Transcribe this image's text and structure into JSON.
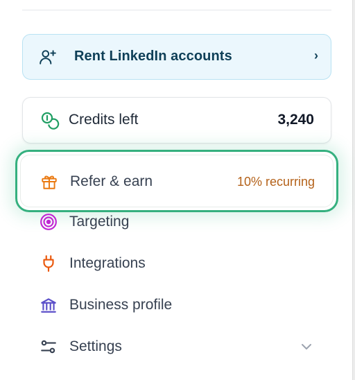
{
  "rent_card": {
    "label": "Rent LinkedIn accounts",
    "chevron": "›",
    "icon": "user-plus-icon"
  },
  "credits": {
    "label": "Credits left",
    "value": "3,240",
    "icon": "coins-icon"
  },
  "refer": {
    "label": "Refer & earn",
    "badge": "10% recurring",
    "icon": "gift-icon"
  },
  "nav": [
    {
      "label": "Targeting",
      "icon": "target-icon",
      "color": "#c026d3"
    },
    {
      "label": "Integrations",
      "icon": "plug-icon",
      "color": "#ea580c"
    },
    {
      "label": "Business profile",
      "icon": "bank-icon",
      "color": "#5b4fc9"
    },
    {
      "label": "Settings",
      "icon": "sliders-icon",
      "color": "#374151"
    }
  ],
  "colors": {
    "accent_green": "#35b07f",
    "rent_bg": "#ebf7fd",
    "rent_text": "#0e3f57",
    "badge_orange": "#b4621a"
  }
}
